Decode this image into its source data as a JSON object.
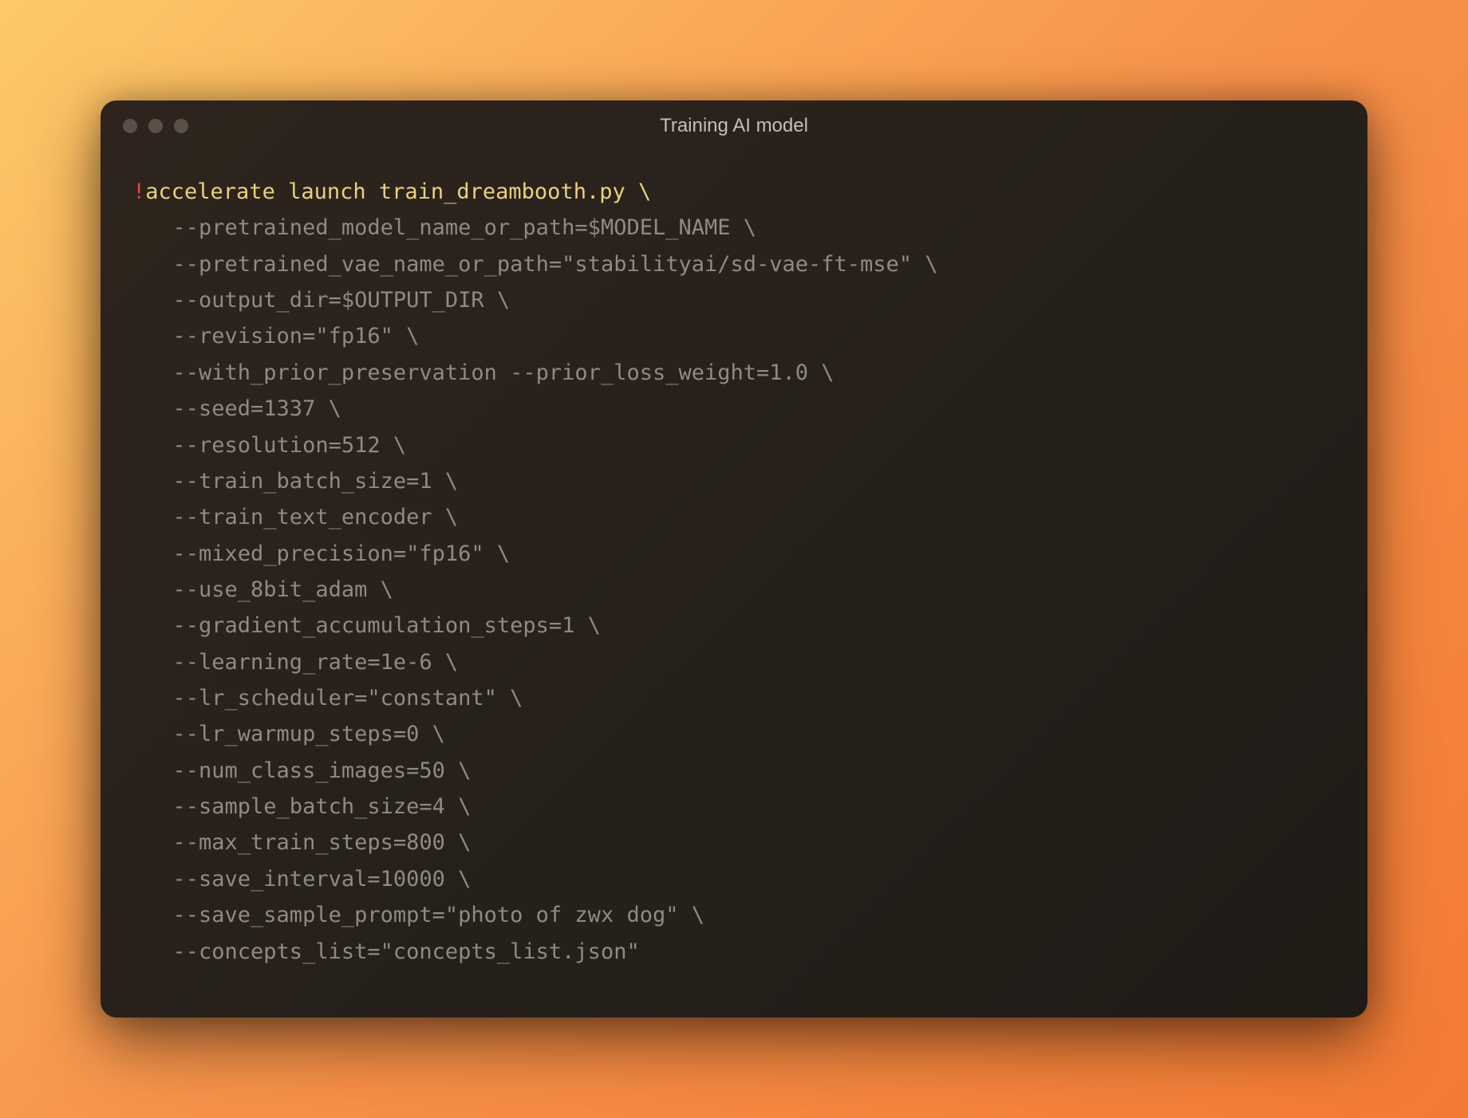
{
  "window": {
    "title": "Training AI model"
  },
  "code": {
    "bang": "!",
    "command": "accelerate launch train_dreambooth.py",
    "continuation": " \\",
    "args": [
      "--pretrained_model_name_or_path=$MODEL_NAME \\",
      "--pretrained_vae_name_or_path=\"stabilityai/sd-vae-ft-mse\" \\",
      "--output_dir=$OUTPUT_DIR \\",
      "--revision=\"fp16\" \\",
      "--with_prior_preservation --prior_loss_weight=1.0 \\",
      "--seed=1337 \\",
      "--resolution=512 \\",
      "--train_batch_size=1 \\",
      "--train_text_encoder \\",
      "--mixed_precision=\"fp16\" \\",
      "--use_8bit_adam \\",
      "--gradient_accumulation_steps=1 \\",
      "--learning_rate=1e-6 \\",
      "--lr_scheduler=\"constant\" \\",
      "--lr_warmup_steps=0 \\",
      "--num_class_images=50 \\",
      "--sample_batch_size=4 \\",
      "--max_train_steps=800 \\",
      "--save_interval=10000 \\",
      "--save_sample_prompt=\"photo of zwx dog\" \\",
      "--concepts_list=\"concepts_list.json\""
    ]
  }
}
